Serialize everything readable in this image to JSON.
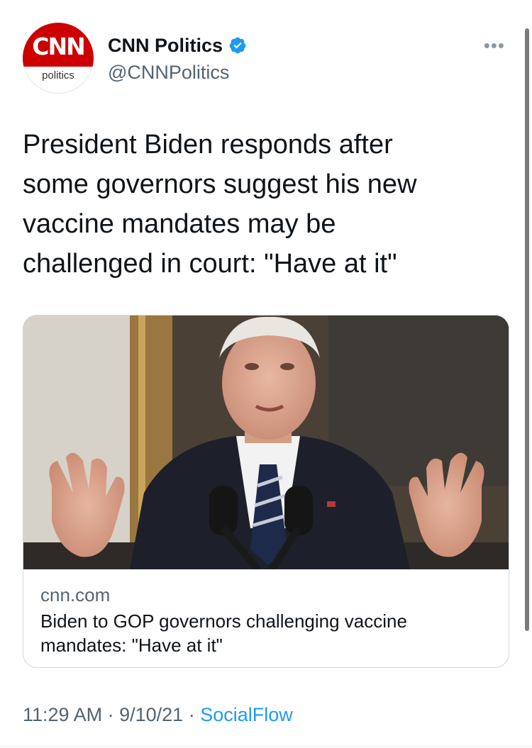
{
  "tweet": {
    "account": {
      "display_name": "CNN Politics",
      "handle": "@CNNPolitics",
      "verified": true,
      "avatar_logo_text": "CNN",
      "avatar_subtext": "politics"
    },
    "more_icon": "•••",
    "text": "President Biden responds after\nsome governors suggest his new\nvaccine mandates may be\nchallenged in court: \"Have at it\"",
    "link_card": {
      "image_alt": "Biden speaking at podium with hands raised",
      "domain": "cnn.com",
      "title": "Biden to GOP governors challenging vaccine mandates: \"Have at it\""
    },
    "meta": {
      "time": "11:29 AM",
      "separator": "·",
      "date": "9/10/21",
      "source": "SocialFlow"
    }
  },
  "colors": {
    "brand_red": "#cc0000",
    "verified_blue": "#1d9bf0",
    "secondary_text": "#536471",
    "primary_text": "#0f1419",
    "border": "#cfd9de"
  },
  "icons": {
    "verified": "verified-badge-icon",
    "more": "more-horizontal-icon"
  }
}
